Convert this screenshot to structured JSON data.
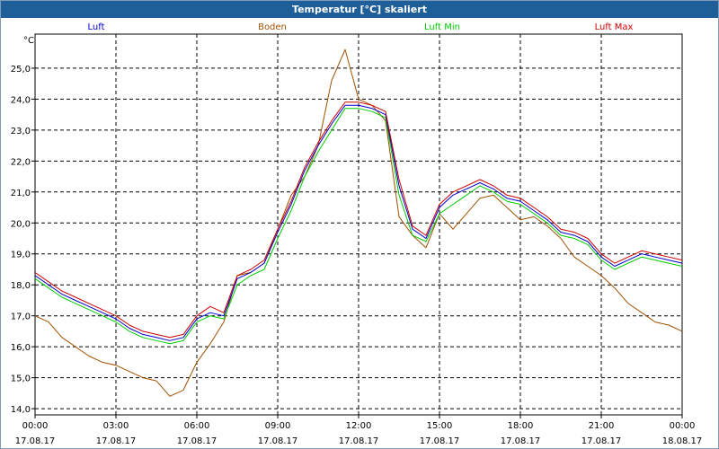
{
  "window": {
    "title": "Temperatur [°C] skaliert"
  },
  "colors": {
    "titlebar": "#1f5f99",
    "grid": "#000000"
  },
  "chart_data": {
    "type": "line",
    "title": "Temperatur [°C] skaliert",
    "ylabel": "°C",
    "xlabel": "",
    "ylim": [
      13.8,
      26.1
    ],
    "xlim": [
      0,
      24
    ],
    "grid": true,
    "legend_placement": "top",
    "yticks": [
      "14,0",
      "15,0",
      "16,0",
      "17,0",
      "18,0",
      "19,0",
      "20,0",
      "21,0",
      "22,0",
      "23,0",
      "24,0",
      "25,0"
    ],
    "xticks": [
      {
        "x": 0,
        "time": "00:00",
        "date": "17.08.17"
      },
      {
        "x": 3,
        "time": "03:00",
        "date": "17.08.17"
      },
      {
        "x": 6,
        "time": "06:00",
        "date": "17.08.17"
      },
      {
        "x": 9,
        "time": "09:00",
        "date": "17.08.17"
      },
      {
        "x": 12,
        "time": "12:00",
        "date": "17.08.17"
      },
      {
        "x": 15,
        "time": "15:00",
        "date": "17.08.17"
      },
      {
        "x": 18,
        "time": "18:00",
        "date": "17.08.17"
      },
      {
        "x": 21,
        "time": "21:00",
        "date": "17.08.17"
      },
      {
        "x": 24,
        "time": "00:00",
        "date": "18.08.17"
      }
    ],
    "series": [
      {
        "name": "Luft",
        "color": "#0000cc",
        "x": [
          0,
          0.5,
          1,
          1.5,
          2,
          2.5,
          3,
          3.5,
          4,
          4.5,
          5,
          5.5,
          6,
          6.5,
          7,
          7.5,
          8,
          8.5,
          9,
          9.5,
          10,
          10.5,
          11,
          11.5,
          12,
          12.5,
          13,
          13.5,
          14,
          14.5,
          15,
          15.5,
          16,
          16.5,
          17,
          17.5,
          18,
          18.5,
          19,
          19.5,
          20,
          20.5,
          21,
          21.5,
          22,
          22.5,
          23,
          23.5,
          24
        ],
        "values": [
          18.3,
          18.0,
          17.7,
          17.5,
          17.3,
          17.1,
          16.9,
          16.6,
          16.4,
          16.3,
          16.2,
          16.3,
          16.9,
          17.1,
          17.0,
          18.2,
          18.4,
          18.7,
          19.7,
          20.6,
          21.7,
          22.5,
          23.2,
          23.8,
          23.8,
          23.7,
          23.5,
          21.2,
          19.8,
          19.5,
          20.5,
          20.9,
          21.1,
          21.3,
          21.1,
          20.8,
          20.7,
          20.4,
          20.1,
          19.7,
          19.6,
          19.4,
          18.9,
          18.6,
          18.8,
          19.0,
          18.9,
          18.8,
          18.7
        ]
      },
      {
        "name": "Boden",
        "color": "#a05000",
        "x": [
          0,
          0.5,
          1,
          1.5,
          2,
          2.5,
          3,
          3.5,
          4,
          4.5,
          5,
          5.5,
          6,
          6.5,
          7,
          7.5,
          8,
          8.5,
          9,
          9.5,
          10,
          10.5,
          11,
          11.5,
          12,
          12.5,
          13,
          13.5,
          14,
          14.5,
          15,
          15.5,
          16,
          16.5,
          17,
          17.5,
          18,
          18.5,
          19,
          19.5,
          20,
          20.5,
          21,
          21.5,
          22,
          22.5,
          23,
          23.5,
          24
        ],
        "values": [
          17.0,
          16.8,
          16.3,
          16.0,
          15.7,
          15.5,
          15.4,
          15.2,
          15.0,
          14.9,
          14.4,
          14.6,
          15.5,
          16.1,
          16.8,
          18.3,
          18.4,
          18.7,
          19.8,
          20.9,
          21.5,
          22.5,
          24.6,
          25.6,
          24.0,
          23.8,
          23.3,
          20.2,
          19.6,
          19.2,
          20.3,
          19.8,
          20.3,
          20.8,
          20.9,
          20.5,
          20.1,
          20.2,
          19.9,
          19.5,
          18.9,
          18.6,
          18.3,
          17.9,
          17.4,
          17.1,
          16.8,
          16.7,
          16.5
        ]
      },
      {
        "name": "Luft Min",
        "color": "#00cc00",
        "x": [
          0,
          0.5,
          1,
          1.5,
          2,
          2.5,
          3,
          3.5,
          4,
          4.5,
          5,
          5.5,
          6,
          6.5,
          7,
          7.5,
          8,
          8.5,
          9,
          9.5,
          10,
          10.5,
          11,
          11.5,
          12,
          12.5,
          13,
          13.5,
          14,
          14.5,
          15,
          15.5,
          16,
          16.5,
          17,
          17.5,
          18,
          18.5,
          19,
          19.5,
          20,
          20.5,
          21,
          21.5,
          22,
          22.5,
          23,
          23.5,
          24
        ],
        "values": [
          18.2,
          17.9,
          17.6,
          17.4,
          17.2,
          17.0,
          16.8,
          16.5,
          16.3,
          16.2,
          16.1,
          16.2,
          16.8,
          17.0,
          16.9,
          18.0,
          18.3,
          18.5,
          19.5,
          20.4,
          21.5,
          22.3,
          23.0,
          23.7,
          23.7,
          23.6,
          23.4,
          20.9,
          19.6,
          19.4,
          20.3,
          20.6,
          20.9,
          21.2,
          21.0,
          20.7,
          20.6,
          20.3,
          20.0,
          19.6,
          19.5,
          19.3,
          18.8,
          18.5,
          18.7,
          18.9,
          18.8,
          18.7,
          18.6
        ]
      },
      {
        "name": "Luft Max",
        "color": "#cc0000",
        "x": [
          0,
          0.5,
          1,
          1.5,
          2,
          2.5,
          3,
          3.5,
          4,
          4.5,
          5,
          5.5,
          6,
          6.5,
          7,
          7.5,
          8,
          8.5,
          9,
          9.5,
          10,
          10.5,
          11,
          11.5,
          12,
          12.5,
          13,
          13.5,
          14,
          14.5,
          15,
          15.5,
          16,
          16.5,
          17,
          17.5,
          18,
          18.5,
          19,
          19.5,
          20,
          20.5,
          21,
          21.5,
          22,
          22.5,
          23,
          23.5,
          24
        ],
        "values": [
          18.4,
          18.1,
          17.8,
          17.6,
          17.4,
          17.2,
          17.0,
          16.7,
          16.5,
          16.4,
          16.3,
          16.4,
          17.0,
          17.3,
          17.1,
          18.3,
          18.5,
          18.8,
          19.8,
          20.7,
          21.8,
          22.6,
          23.3,
          23.9,
          23.9,
          23.8,
          23.6,
          21.4,
          19.9,
          19.6,
          20.6,
          21.0,
          21.2,
          21.4,
          21.2,
          20.9,
          20.8,
          20.5,
          20.2,
          19.8,
          19.7,
          19.5,
          19.0,
          18.7,
          18.9,
          19.1,
          19.0,
          18.9,
          18.8
        ]
      }
    ]
  }
}
